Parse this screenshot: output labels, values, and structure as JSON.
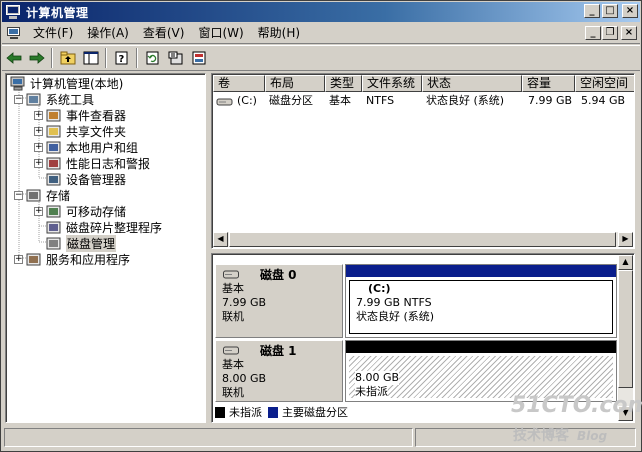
{
  "window": {
    "title": "计算机管理"
  },
  "caption_buttons": {
    "minimize": "_",
    "maximize": "□",
    "close": "×"
  },
  "menu": [
    "文件(F)",
    "操作(A)",
    "查看(V)",
    "窗口(W)",
    "帮助(H)"
  ],
  "mdi_buttons": {
    "minimize": "_",
    "restore": "❐",
    "close": "×"
  },
  "toolbar": {
    "buttons": [
      "back-icon",
      "forward-icon",
      "up-folder-icon",
      "show-hide-tree-icon",
      "help-icon",
      "refresh-icon",
      "properties-icon",
      "export-icon"
    ]
  },
  "tree": {
    "root": "计算机管理(本地)",
    "items": [
      {
        "label": "系统工具",
        "level": 1,
        "expander": "−",
        "icon": "system-tools-icon"
      },
      {
        "label": "事件查看器",
        "level": 2,
        "expander": "+",
        "icon": "event-viewer-icon"
      },
      {
        "label": "共享文件夹",
        "level": 2,
        "expander": "+",
        "icon": "shared-folder-icon"
      },
      {
        "label": "本地用户和组",
        "level": 2,
        "expander": "+",
        "icon": "users-icon"
      },
      {
        "label": "性能日志和警报",
        "level": 2,
        "expander": "+",
        "icon": "performance-icon"
      },
      {
        "label": "设备管理器",
        "level": 2,
        "expander": "",
        "icon": "device-manager-icon"
      },
      {
        "label": "存储",
        "level": 1,
        "expander": "−",
        "icon": "storage-icon"
      },
      {
        "label": "可移动存储",
        "level": 2,
        "expander": "+",
        "icon": "removable-storage-icon"
      },
      {
        "label": "磁盘碎片整理程序",
        "level": 2,
        "expander": "",
        "icon": "defrag-icon"
      },
      {
        "label": "磁盘管理",
        "level": 2,
        "expander": "",
        "icon": "disk-management-icon",
        "selected": true
      },
      {
        "label": "服务和应用程序",
        "level": 1,
        "expander": "+",
        "icon": "services-icon"
      }
    ]
  },
  "volume_list": {
    "columns": [
      "卷",
      "布局",
      "类型",
      "文件系统",
      "状态",
      "容量",
      "空闲空间"
    ],
    "rows": [
      {
        "volume": "(C:)",
        "layout": "磁盘分区",
        "type": "基本",
        "fs": "NTFS",
        "status": "状态良好 (系统)",
        "capacity": "7.99 GB",
        "free": "5.94 GB"
      }
    ]
  },
  "disks": [
    {
      "name": "磁盘 0",
      "type": "基本",
      "size": "7.99 GB",
      "state": "联机",
      "volume_label": "(C:)",
      "volume_size": "7.99 GB NTFS",
      "volume_status": "状态良好 (系统)",
      "bar_color": "#0a1e8c"
    },
    {
      "name": "磁盘 1",
      "type": "基本",
      "size": "8.00 GB",
      "state": "联机",
      "volume_size": "8.00 GB",
      "volume_status": "未指派",
      "bar_color": "#000000"
    }
  ],
  "legend": [
    {
      "label": "未指派",
      "color": "#000000"
    },
    {
      "label": "主要磁盘分区",
      "color": "#0a1e8c"
    }
  ],
  "watermark": {
    "main": "51CTO.com",
    "sub": "技术博客",
    "blog": "Blog"
  }
}
